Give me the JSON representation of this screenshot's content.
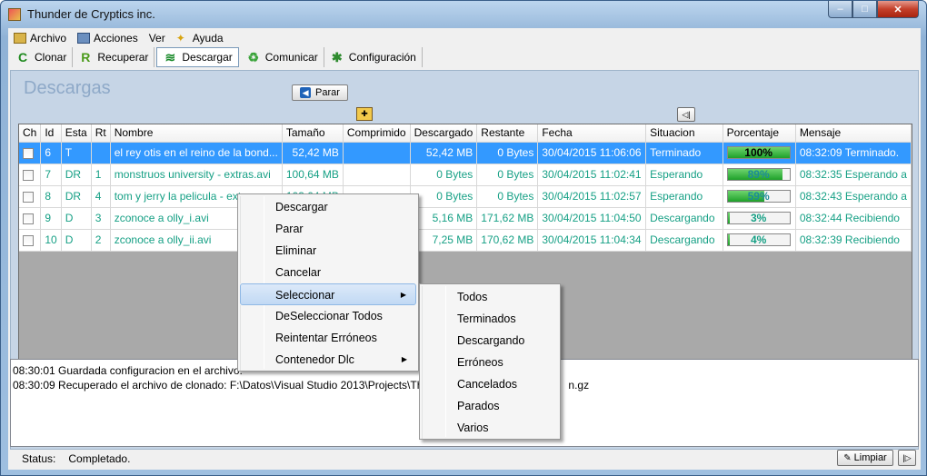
{
  "window": {
    "title": "Thunder de Cryptics inc.",
    "min": "–",
    "max": "□",
    "close": "✕"
  },
  "menu": [
    {
      "label": "Archivo",
      "icon": "archive-icon"
    },
    {
      "label": "Acciones",
      "icon": "actions-icon"
    },
    {
      "label": "Ver",
      "icon": ""
    },
    {
      "label": "Ayuda",
      "icon": "help-icon"
    }
  ],
  "toolbar": [
    {
      "label": "Clonar",
      "icon": "clone-icon",
      "glyph": "C",
      "color": "#1f8a1f"
    },
    {
      "label": "Recuperar",
      "icon": "recover-icon",
      "glyph": "R",
      "color": "#4a9a1a"
    },
    {
      "label": "Descargar",
      "icon": "download-icon",
      "glyph": "≋",
      "color": "#1a8a2a"
    },
    {
      "label": "Comunicar",
      "icon": "recycle-icon",
      "glyph": "♻",
      "color": "#3aa33a"
    },
    {
      "label": "Configuración",
      "icon": "gear-icon",
      "glyph": "✱",
      "color": "#2e8b2e"
    }
  ],
  "section": {
    "title": "Descargas",
    "stop_button": "Parar"
  },
  "table": {
    "headers": [
      "Ch",
      "Id",
      "Esta",
      "Rt",
      "Nombre",
      "Tamaño",
      "Comprimido",
      "Descargado",
      "Restante",
      "Fecha",
      "Situacion",
      "Porcentaje",
      "Mensaje"
    ],
    "rows": [
      {
        "id": "6",
        "estado": "T",
        "r": "",
        "nombre": "el rey otis en el reino de la bond...",
        "tamano": "52,42 MB",
        "comprimido": "",
        "descargado": "52,42 MB",
        "restante": "0 Bytes",
        "fecha": "30/04/2015 11:06:06",
        "situacion": "Terminado",
        "porcentaje": "100%",
        "pct": 1.0,
        "mensaje": "08:32:09 Terminado.",
        "selected": true
      },
      {
        "id": "7",
        "estado": "DR",
        "r": "1",
        "nombre": "monstruos university - extras.avi",
        "tamano": "100,64 MB",
        "comprimido": "",
        "descargado": "0 Bytes",
        "restante": "0 Bytes",
        "fecha": "30/04/2015 11:02:41",
        "situacion": "Esperando",
        "porcentaje": "89%",
        "pct": 0.89,
        "mensaje": "08:32:35 Esperando a",
        "selected": false
      },
      {
        "id": "8",
        "estado": "DR",
        "r": "4",
        "nombre": "tom y jerry la pelicula - extras",
        "tamano": "103,04 MB",
        "comprimido": "",
        "descargado": "0 Bytes",
        "restante": "0 Bytes",
        "fecha": "30/04/2015 11:02:57",
        "situacion": "Esperando",
        "porcentaje": "59%",
        "pct": 0.59,
        "mensaje": "08:32:43 Esperando a",
        "selected": false
      },
      {
        "id": "9",
        "estado": "D",
        "r": "3",
        "nombre": "zconoce a olly_i.avi",
        "tamano": "",
        "comprimido": "",
        "descargado": "5,16 MB",
        "restante": "171,62 MB",
        "fecha": "30/04/2015 11:04:50",
        "situacion": "Descargando",
        "porcentaje": "3%",
        "pct": 0.03,
        "mensaje": "08:32:44 Recibiendo",
        "selected": false
      },
      {
        "id": "10",
        "estado": "D",
        "r": "2",
        "nombre": "zconoce a olly_ii.avi",
        "tamano": "",
        "comprimido": "",
        "descargado": "7,25 MB",
        "restante": "170,62 MB",
        "fecha": "30/04/2015 11:04:34",
        "situacion": "Descargando",
        "porcentaje": "4%",
        "pct": 0.04,
        "mensaje": "08:32:39 Recibiendo",
        "selected": false
      }
    ]
  },
  "log": [
    "08:30:01 Guardada configuracion en el archivo:",
    "08:30:09 Recuperado el archivo de clonado: F:\\Datos\\Visual Studio 2013\\Projects\\Th",
    "n.gz"
  ],
  "status": {
    "label": "Status:",
    "value": "Completado.",
    "clear_button": "Limpiar"
  },
  "context_menu": [
    {
      "label": "Descargar",
      "submenu": false
    },
    {
      "label": "Parar",
      "submenu": false
    },
    {
      "label": "Eliminar",
      "submenu": false
    },
    {
      "label": "Cancelar",
      "submenu": false
    },
    {
      "label": "Seleccionar",
      "submenu": true,
      "highlighted": true
    },
    {
      "label": "DeSeleccionar Todos",
      "submenu": false
    },
    {
      "label": "Reintentar Erróneos",
      "submenu": false
    },
    {
      "label": "Contenedor Dlc",
      "submenu": true
    }
  ],
  "submenu": [
    "Todos",
    "Terminados",
    "Descargando",
    "Erróneos",
    "Cancelados",
    "Parados",
    "Varios"
  ],
  "colors": {
    "accent": "#3399ff",
    "row_text": "#16a085",
    "title_text": "#8ea9c8",
    "progress": "#1ea12a"
  }
}
